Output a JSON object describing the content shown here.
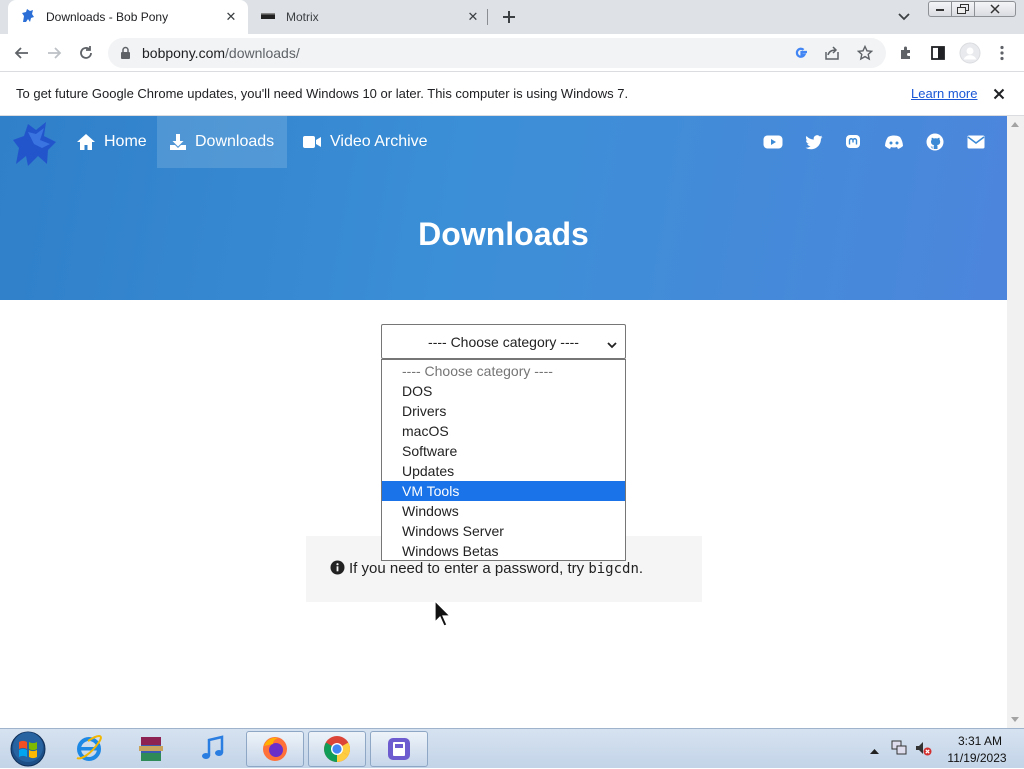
{
  "browser": {
    "tabs": [
      {
        "title": "Downloads - Bob Pony",
        "active": true
      },
      {
        "title": "Motrix",
        "active": false
      }
    ],
    "url_host": "bobpony.com",
    "url_path": "/downloads/",
    "infobar": {
      "message": "To get future Google Chrome updates, you'll need Windows 10 or later. This computer is using Windows 7.",
      "link": "Learn more"
    }
  },
  "site": {
    "nav": [
      {
        "label": "Home",
        "icon": "home-icon"
      },
      {
        "label": "Downloads",
        "icon": "download-icon"
      },
      {
        "label": "Video Archive",
        "icon": "video-camera-icon"
      }
    ],
    "social_icons": [
      "youtube-icon",
      "twitter-icon",
      "mastodon-icon",
      "discord-icon",
      "github-icon",
      "email-icon"
    ],
    "page_title": "Downloads",
    "category_select": {
      "selected_label": "---- Choose category ----",
      "options": [
        "---- Choose category ----",
        "DOS",
        "Drivers",
        "macOS",
        "Software",
        "Updates",
        "VM Tools",
        "Windows",
        "Windows Server",
        "Windows Betas"
      ],
      "highlighted": "VM Tools"
    },
    "notice": {
      "text": "If you need to enter a password, try",
      "code": "bigcdn",
      "suffix": "."
    },
    "colors": {
      "hero_start": "#2f7fc9",
      "hero_end": "#4c86dc",
      "highlight": "#1a73e8"
    }
  },
  "taskbar": {
    "apps": [
      "internet-explorer-icon",
      "winrar-icon",
      "itunes-icon",
      "firefox-icon",
      "chrome-icon",
      "motrix-icon"
    ],
    "time": "3:31 AM",
    "date": "11/19/2023"
  }
}
